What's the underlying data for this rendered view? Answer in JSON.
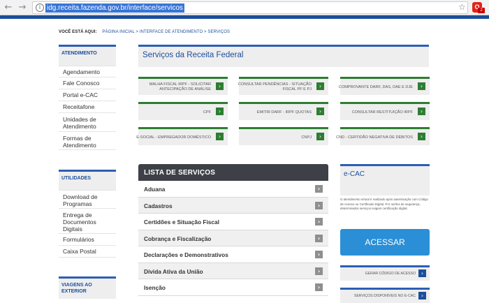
{
  "browser": {
    "url": "idg.receita.fazenda.gov.br/interface/servicos",
    "back_icon": "←",
    "forward_icon": "→",
    "info_icon": "i",
    "star_icon": "☆",
    "ext_icon": "O",
    "ext_badge": "2"
  },
  "breadcrumb": {
    "here": "VOCÊ ESTÁ AQUI:",
    "path": "PÁGINA INICIAL > INTERFACE DE ATENDIMENTO > SERVIÇOS"
  },
  "sidebar": {
    "atendimento": {
      "heading": "ATENDIMENTO",
      "items": [
        "Agendamento",
        "Fale Conosco",
        "Portal e-CAC",
        "Receitafone",
        "Unidades de Atendimento",
        "Formas de Atendimento"
      ]
    },
    "utilidades": {
      "heading": "UTILIDADES",
      "items": [
        "Download de Programas",
        "Entrega de Documentos Digitais",
        "Formulários",
        "Caixa Postal"
      ]
    },
    "viagens": {
      "heading": "VIAGENS AO EXTERIOR"
    }
  },
  "main": {
    "title": "Serviços da Receita Federal",
    "services": [
      "MALHA FISCAL IRPF - SOLICITAR ANTECIPAÇÃO DE ANÁLISE",
      "CONSULTAR PENDÊNCIAS - SITUAÇÃO FISCAL PF E PJ",
      "COMPROVANTE DARF, DAS, DAE E DJE",
      "CPF",
      "EMITIR DARF - IRPF QUOTAS",
      "CONSULTAR RESTITUIÇÃO IRPF",
      "E-SOCIAL - EMPREGADOR DOMÉSTICO",
      "CNPJ",
      "CND - CERTIDÃO NEGATIVA DE DÉBITOS"
    ],
    "arrow_glyph": "›"
  },
  "lista": {
    "heading": "LISTA DE SERVIÇOS",
    "items": [
      "Aduana",
      "Cadastros",
      "Certidões e Situação Fiscal",
      "Cobrança e Fiscalização",
      "Declarações e Demonstrativos",
      "Dívida Ativa da União",
      "Isenção"
    ]
  },
  "ecac": {
    "title": "e-CAC",
    "text": "O atendimento virtual é realizado após autenticação com Código de Acesso ou Certificado Digital. Por razões de segurança, determinados serviços exigem certificação digital.",
    "button": "ACESSAR",
    "links": [
      "GERAR CÓDIGO DE ACESSO",
      "SERVIÇOS DISPONÍVEIS NO E-CAC"
    ]
  }
}
